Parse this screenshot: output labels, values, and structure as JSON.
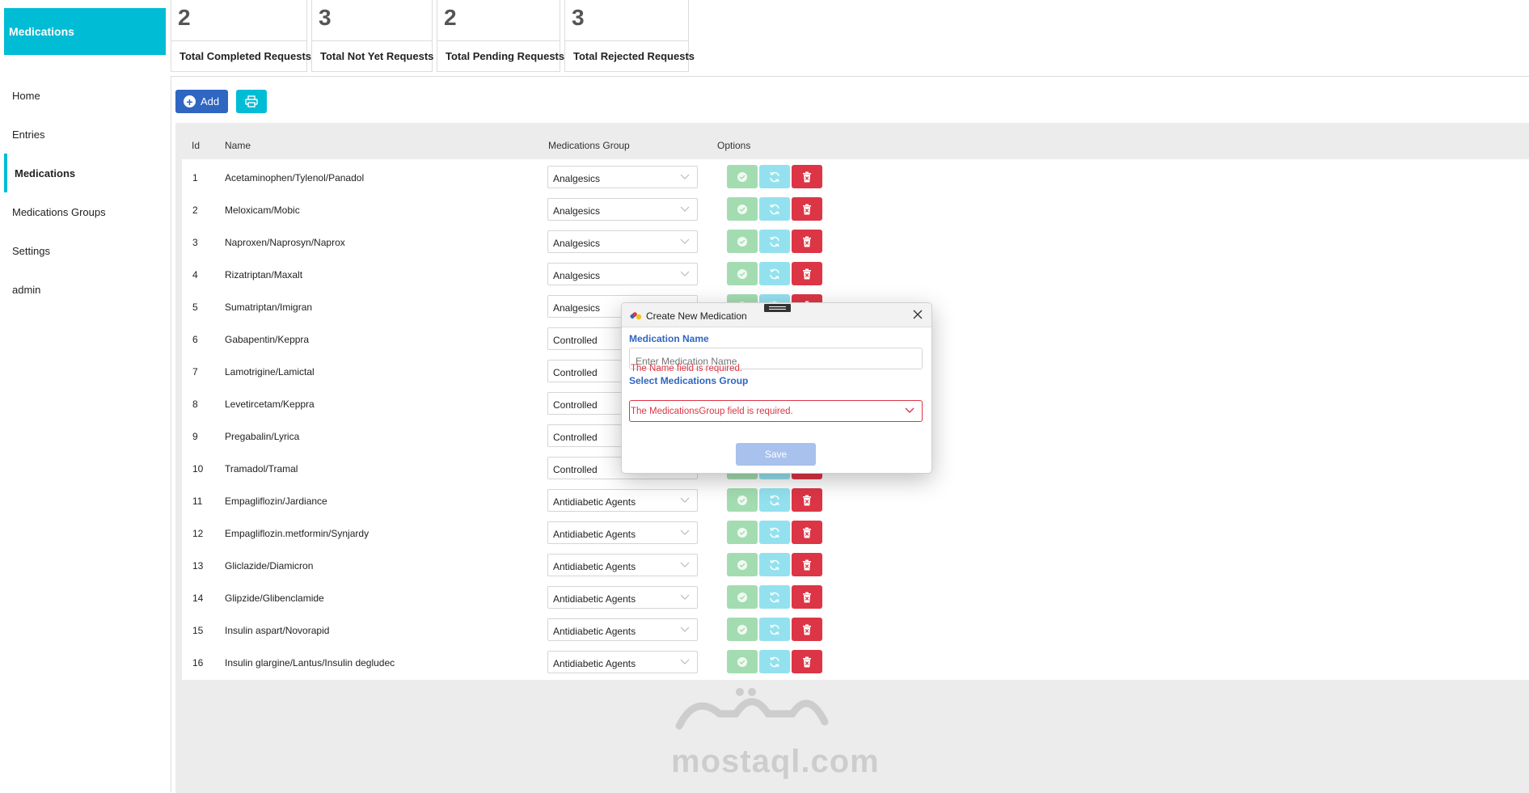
{
  "sidebar": {
    "brand": "Medications",
    "items": [
      {
        "label": "Home"
      },
      {
        "label": "Entries"
      },
      {
        "label": "Medications"
      },
      {
        "label": "Medications Groups"
      },
      {
        "label": "Settings"
      },
      {
        "label": "admin"
      }
    ],
    "active_index": 2
  },
  "stats": [
    {
      "value": "2",
      "label": "Total Completed Requests"
    },
    {
      "value": "3",
      "label": "Total Not Yet Requests"
    },
    {
      "value": "2",
      "label": "Total Pending Requests"
    },
    {
      "value": "3",
      "label": "Total Rejected Requests"
    }
  ],
  "toolbar": {
    "add_label": "Add",
    "add_icon": "plus-circle-icon",
    "print_icon": "printer-icon"
  },
  "table": {
    "headers": {
      "id": "Id",
      "name": "Name",
      "group": "Medications Group",
      "options": "Options"
    },
    "rows": [
      {
        "id": "1",
        "name": "Acetaminophen/Tylenol/Panadol",
        "group": "Analgesics"
      },
      {
        "id": "2",
        "name": "Meloxicam/Mobic",
        "group": "Analgesics"
      },
      {
        "id": "3",
        "name": "Naproxen/Naprosyn/Naprox",
        "group": "Analgesics"
      },
      {
        "id": "4",
        "name": "Rizatriptan/Maxalt",
        "group": "Analgesics"
      },
      {
        "id": "5",
        "name": "Sumatriptan/Imigran",
        "group": "Analgesics"
      },
      {
        "id": "6",
        "name": "Gabapentin/Keppra",
        "group": "Controlled"
      },
      {
        "id": "7",
        "name": "Lamotrigine/Lamictal",
        "group": "Controlled"
      },
      {
        "id": "8",
        "name": "Levetircetam/Keppra",
        "group": "Controlled"
      },
      {
        "id": "9",
        "name": "Pregabalin/Lyrica",
        "group": "Controlled"
      },
      {
        "id": "10",
        "name": "Tramadol/Tramal",
        "group": "Controlled"
      },
      {
        "id": "11",
        "name": "Empagliflozin/Jardiance",
        "group": "Antidiabetic Agents"
      },
      {
        "id": "12",
        "name": "Empagliflozin.metformin/Synjardy",
        "group": "Antidiabetic Agents"
      },
      {
        "id": "13",
        "name": "Gliclazide/Diamicron",
        "group": "Antidiabetic Agents"
      },
      {
        "id": "14",
        "name": "Glipzide/Glibenclamide",
        "group": "Antidiabetic Agents"
      },
      {
        "id": "15",
        "name": "Insulin aspart/Novorapid",
        "group": "Antidiabetic Agents"
      },
      {
        "id": "16",
        "name": "Insulin glargine/Lantus/Insulin degludec",
        "group": "Antidiabetic Agents"
      }
    ]
  },
  "dialog": {
    "title": "Create New Medication",
    "name_label": "Medication Name",
    "name_placeholder": "Enter Medication Name",
    "name_value": "",
    "name_error": "The Name field is required.",
    "group_label": "Select Medications Group",
    "group_value": "",
    "group_error": "The MedicationsGroup field is required.",
    "save_label": "Save"
  },
  "watermark": {
    "text": "mostaql.com"
  },
  "colors": {
    "accent": "#00bcd4",
    "primary": "#2f66c2",
    "danger": "#dc3545",
    "success_light": "#a3dcb0",
    "info_light": "#93e1ee"
  }
}
